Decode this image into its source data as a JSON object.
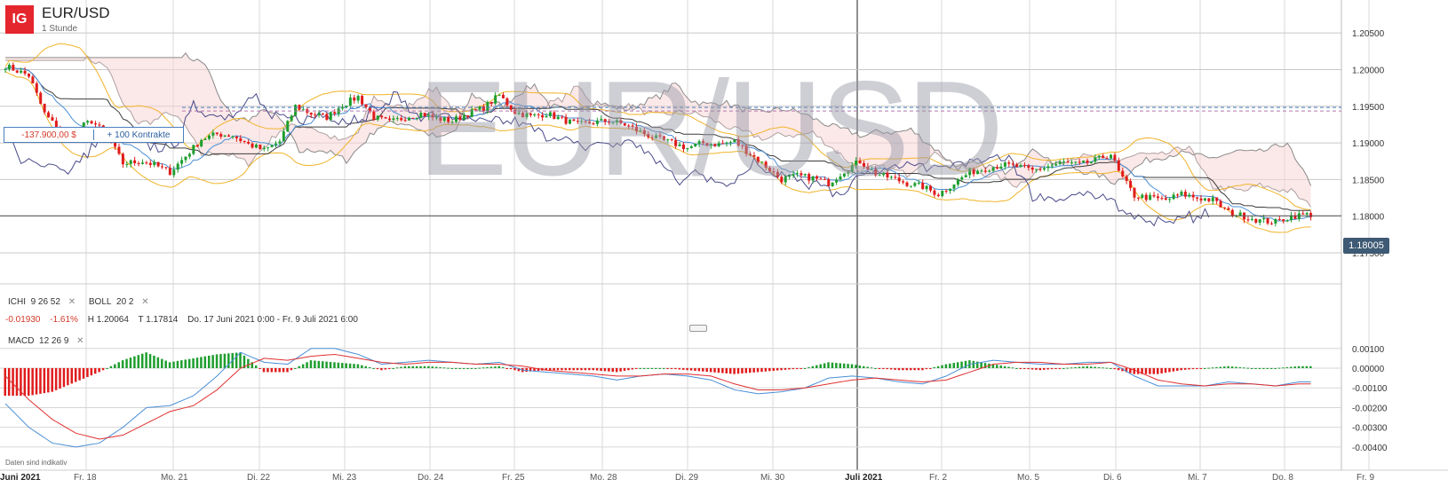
{
  "header": {
    "logo": "IG",
    "instrument": "EUR/USD",
    "interval": "1 Stunde",
    "watermark": "EUR/USD"
  },
  "position": {
    "pl": "-137.900,00 $",
    "size": "+ 100 Kontrakte"
  },
  "last_price_tag": "1.18005",
  "indicators": {
    "ichi": {
      "name": "ICHI",
      "params": "9  26  52",
      "close": "✕"
    },
    "boll": {
      "name": "BOLL",
      "params": "20  2",
      "close": "✕"
    },
    "macd": {
      "name": "MACD",
      "params": "12  26  9",
      "close": "✕"
    }
  },
  "stats": {
    "change": "-0.01930",
    "change_pct": "-1.61%",
    "high": "H 1.20064",
    "low": "T 1.17814",
    "range": "Do. 17 Juni 2021 0:00 - Fr. 9 Juli 2021 6:00"
  },
  "footnote": "Daten sind indikativ",
  "colors": {
    "up": "#1e9e2e",
    "down": "#e01b1b",
    "bollinger": "#f0b429",
    "ichi_base": "#3c3c3c",
    "ichi_conv": "#4a8fd6",
    "ichi_lag": "#4a4a8a",
    "cloud_fill": "#f7d6d6",
    "macd_line": "#4a8fd6",
    "signal_line": "#e03030",
    "position_line": "#4a7fc1"
  },
  "chart_data": [
    {
      "type": "candlestick",
      "title": "EUR/USD",
      "ylim": [
        1.171,
        1.2095
      ],
      "y_ticks": [
        "1.20500",
        "1.20000",
        "1.19500",
        "1.19000",
        "1.18500",
        "1.18000",
        "1.17500"
      ],
      "x_labels": [
        "Juni 2021",
        "Fr. 18",
        "Mo. 21",
        "Di. 22",
        "Mi. 23",
        "Do. 24",
        "Fr. 25",
        "Mo. 28",
        "Di. 29",
        "Mi. 30",
        "Juli 2021",
        "Fr. 2",
        "Mo. 5",
        "Di. 6",
        "Mi. 7",
        "Do. 8",
        "Fr. 9"
      ],
      "position_line": 1.1946,
      "last_price": 1.18005,
      "high": 1.20064,
      "low": 1.17814,
      "close_path": [
        [
          0,
          1.2005
        ],
        [
          6,
          1.1992
        ],
        [
          10,
          1.194
        ],
        [
          14,
          1.1915
        ],
        [
          18,
          1.1918
        ],
        [
          22,
          1.193
        ],
        [
          26,
          1.191
        ],
        [
          30,
          1.1872
        ],
        [
          35,
          1.1875
        ],
        [
          38,
          1.187
        ],
        [
          42,
          1.186
        ],
        [
          46,
          1.1882
        ],
        [
          50,
          1.1905
        ],
        [
          54,
          1.1912
        ],
        [
          58,
          1.191
        ],
        [
          62,
          1.1898
        ],
        [
          66,
          1.189
        ],
        [
          70,
          1.1902
        ],
        [
          74,
          1.195
        ],
        [
          78,
          1.194
        ],
        [
          82,
          1.1935
        ],
        [
          86,
          1.1952
        ],
        [
          90,
          1.1963
        ],
        [
          94,
          1.1935
        ],
        [
          98,
          1.1928
        ],
        [
          102,
          1.1935
        ],
        [
          106,
          1.194
        ],
        [
          110,
          1.1933
        ],
        [
          114,
          1.193
        ],
        [
          118,
          1.194
        ],
        [
          122,
          1.1948
        ],
        [
          126,
          1.1965
        ],
        [
          130,
          1.1942
        ],
        [
          134,
          1.1936
        ],
        [
          138,
          1.194
        ],
        [
          142,
          1.1932
        ],
        [
          146,
          1.1925
        ],
        [
          150,
          1.1928
        ],
        [
          154,
          1.193
        ],
        [
          158,
          1.1925
        ],
        [
          162,
          1.1915
        ],
        [
          166,
          1.1906
        ],
        [
          170,
          1.19
        ],
        [
          174,
          1.1893
        ],
        [
          178,
          1.19
        ],
        [
          182,
          1.1898
        ],
        [
          186,
          1.1902
        ],
        [
          190,
          1.1885
        ],
        [
          194,
          1.1868
        ],
        [
          198,
          1.185
        ],
        [
          202,
          1.1855
        ],
        [
          206,
          1.1852
        ],
        [
          210,
          1.1845
        ],
        [
          214,
          1.1862
        ],
        [
          218,
          1.1875
        ],
        [
          222,
          1.1858
        ],
        [
          226,
          1.1852
        ],
        [
          230,
          1.1845
        ],
        [
          234,
          1.184
        ],
        [
          238,
          1.183
        ],
        [
          242,
          1.1845
        ],
        [
          246,
          1.186
        ],
        [
          250,
          1.1865
        ],
        [
          254,
          1.187
        ],
        [
          258,
          1.1868
        ],
        [
          262,
          1.1862
        ],
        [
          266,
          1.1868
        ],
        [
          270,
          1.1873
        ],
        [
          274,
          1.187
        ],
        [
          278,
          1.1876
        ],
        [
          282,
          1.1885
        ],
        [
          284,
          1.186
        ],
        [
          288,
          1.1828
        ],
        [
          292,
          1.1825
        ],
        [
          296,
          1.1822
        ],
        [
          300,
          1.183
        ],
        [
          304,
          1.1825
        ],
        [
          308,
          1.1822
        ],
        [
          312,
          1.1805
        ],
        [
          316,
          1.18
        ],
        [
          320,
          1.1794
        ],
        [
          324,
          1.1792
        ],
        [
          328,
          1.18
        ],
        [
          332,
          1.1802
        ]
      ]
    },
    {
      "type": "macd",
      "ylim": [
        -0.0045,
        0.00135
      ],
      "y_ticks": [
        "0.00100",
        "0.00000",
        "-0.00100",
        "-0.00200",
        "-0.00300",
        "-0.00400"
      ],
      "macd_path": [
        [
          0,
          -0.0018
        ],
        [
          6,
          -0.003
        ],
        [
          12,
          -0.0038
        ],
        [
          18,
          -0.004
        ],
        [
          24,
          -0.0038
        ],
        [
          30,
          -0.003
        ],
        [
          36,
          -0.002
        ],
        [
          42,
          -0.0019
        ],
        [
          48,
          -0.0014
        ],
        [
          54,
          -0.0004
        ],
        [
          60,
          0.0008
        ],
        [
          66,
          0.0003
        ],
        [
          72,
          0.0002
        ],
        [
          78,
          0.001
        ],
        [
          84,
          0.001
        ],
        [
          90,
          0.0007
        ],
        [
          96,
          0.0002
        ],
        [
          102,
          0.0003
        ],
        [
          108,
          0.0004
        ],
        [
          114,
          0.0003
        ],
        [
          120,
          0.0002
        ],
        [
          126,
          0.0003
        ],
        [
          132,
          -0.0001
        ],
        [
          138,
          -0.0002
        ],
        [
          144,
          -0.0003
        ],
        [
          150,
          -0.0004
        ],
        [
          156,
          -0.0006
        ],
        [
          162,
          -0.0004
        ],
        [
          168,
          -0.0003
        ],
        [
          174,
          -0.0004
        ],
        [
          180,
          -0.0006
        ],
        [
          186,
          -0.0011
        ],
        [
          192,
          -0.0013
        ],
        [
          198,
          -0.0012
        ],
        [
          204,
          -0.001
        ],
        [
          210,
          -0.0005
        ],
        [
          216,
          -0.0004
        ],
        [
          222,
          -0.0005
        ],
        [
          228,
          -0.0007
        ],
        [
          234,
          -0.0008
        ],
        [
          240,
          -0.0004
        ],
        [
          246,
          0.0002
        ],
        [
          252,
          0.0004
        ],
        [
          258,
          0.0003
        ],
        [
          264,
          0.0002
        ],
        [
          270,
          0.0002
        ],
        [
          276,
          0.0003
        ],
        [
          282,
          0.0003
        ],
        [
          288,
          -0.0004
        ],
        [
          294,
          -0.0009
        ],
        [
          300,
          -0.0009
        ],
        [
          306,
          -0.0009
        ],
        [
          312,
          -0.0007
        ],
        [
          318,
          -0.0008
        ],
        [
          324,
          -0.0009
        ],
        [
          330,
          -0.0007
        ]
      ],
      "signal_path": [
        [
          0,
          -0.0004
        ],
        [
          6,
          -0.0016
        ],
        [
          12,
          -0.0026
        ],
        [
          18,
          -0.0033
        ],
        [
          24,
          -0.0036
        ],
        [
          30,
          -0.0034
        ],
        [
          36,
          -0.0028
        ],
        [
          42,
          -0.0022
        ],
        [
          48,
          -0.0019
        ],
        [
          54,
          -0.0011
        ],
        [
          60,
          0.0
        ],
        [
          66,
          0.0005
        ],
        [
          72,
          0.0004
        ],
        [
          78,
          0.0006
        ],
        [
          84,
          0.0007
        ],
        [
          90,
          0.0005
        ],
        [
          96,
          0.0003
        ],
        [
          102,
          0.0002
        ],
        [
          108,
          0.0003
        ],
        [
          114,
          0.0003
        ],
        [
          120,
          0.0002
        ],
        [
          126,
          0.0002
        ],
        [
          132,
          0.0001
        ],
        [
          138,
          -0.0001
        ],
        [
          144,
          -0.0002
        ],
        [
          150,
          -0.0003
        ],
        [
          156,
          -0.0004
        ],
        [
          162,
          -0.0004
        ],
        [
          168,
          -0.0003
        ],
        [
          174,
          -0.0003
        ],
        [
          180,
          -0.0004
        ],
        [
          186,
          -0.0008
        ],
        [
          192,
          -0.0011
        ],
        [
          198,
          -0.0011
        ],
        [
          204,
          -0.001
        ],
        [
          210,
          -0.0008
        ],
        [
          216,
          -0.0006
        ],
        [
          222,
          -0.0005
        ],
        [
          228,
          -0.0006
        ],
        [
          234,
          -0.0007
        ],
        [
          240,
          -0.0006
        ],
        [
          246,
          -0.0002
        ],
        [
          252,
          0.0002
        ],
        [
          258,
          0.0003
        ],
        [
          264,
          0.0003
        ],
        [
          270,
          0.0002
        ],
        [
          276,
          0.0002
        ],
        [
          282,
          0.0003
        ],
        [
          288,
          -0.0001
        ],
        [
          294,
          -0.0006
        ],
        [
          300,
          -0.0008
        ],
        [
          306,
          -0.0009
        ],
        [
          312,
          -0.0008
        ],
        [
          318,
          -0.0008
        ],
        [
          324,
          -0.0009
        ],
        [
          330,
          -0.0008
        ]
      ]
    }
  ]
}
